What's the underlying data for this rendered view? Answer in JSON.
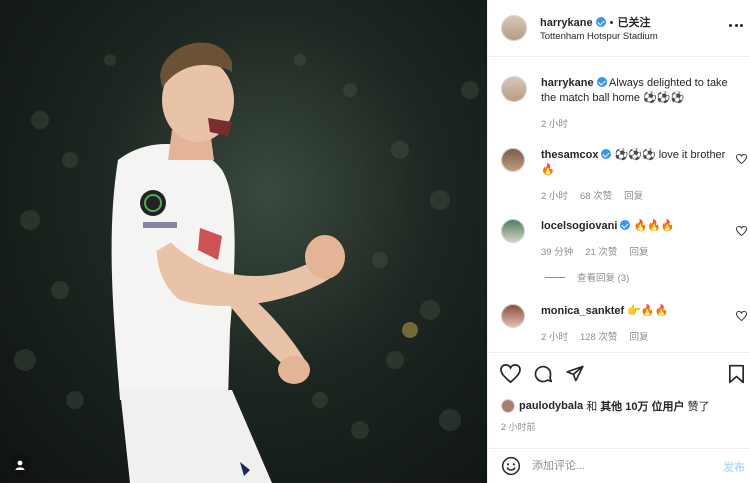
{
  "header": {
    "username": "harrykane",
    "follow_status": "已关注",
    "separator": "•",
    "location": "Tottenham Hotspur Stadium"
  },
  "caption": {
    "username": "harrykane",
    "text": "Always delighted to take the match ball home ⚽⚽⚽",
    "time": "2 小时"
  },
  "comments": [
    {
      "username": "thesamcox",
      "text": "⚽⚽⚽ love it brother 🔥",
      "time": "2 小时",
      "likes": "68 次赞",
      "reply": "回复",
      "verified": true
    },
    {
      "username": "locelsogiovani",
      "text": "🔥🔥🔥",
      "time": "39 分钟",
      "likes": "21 次赞",
      "reply": "回复",
      "verified": true
    },
    {
      "username": "monica_sanktef",
      "text": "👉🔥🔥",
      "time": "2 小时",
      "likes": "128 次赞",
      "reply": "回复",
      "verified": false
    }
  ],
  "view_replies": "查看回复 (3)",
  "likes": {
    "user": "paulodybala",
    "and": "和",
    "others": "其他 10万 位用户",
    "suffix": "赞了"
  },
  "post_time": "2 小时前",
  "add_comment": {
    "placeholder": "添加评论...",
    "post_label": "发布"
  },
  "colors": {
    "verified": "#3897f0",
    "post_disabled": "#b2dffc",
    "muted": "#8e8e8e",
    "kit_white": "#f4f4f2"
  },
  "icons": [
    "heart-icon",
    "comment-icon",
    "share-icon",
    "bookmark-icon",
    "emoji-icon",
    "more-icon",
    "tag-user-icon"
  ]
}
